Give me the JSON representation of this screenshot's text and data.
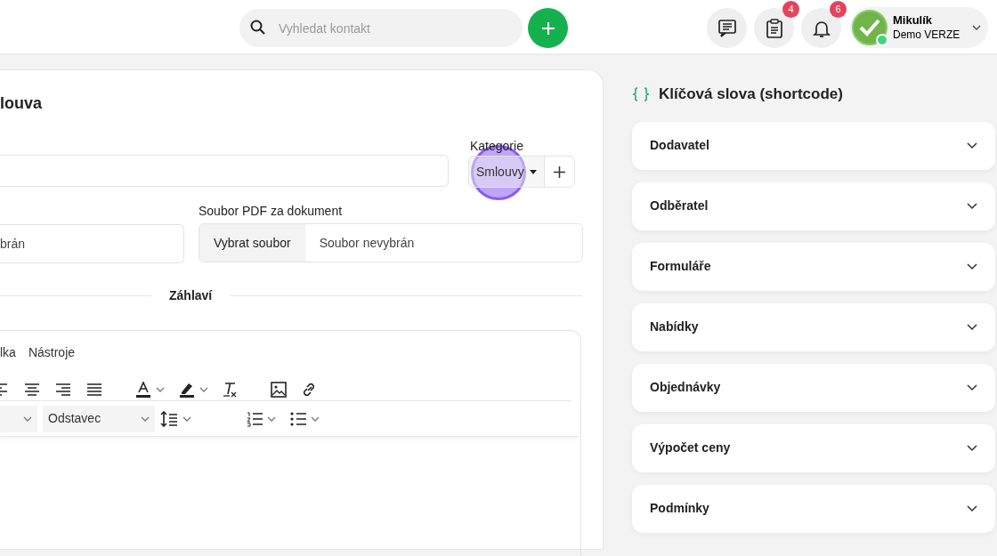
{
  "search": {
    "placeholder": "Vyhledat kontakt"
  },
  "header_buttons": [
    {
      "kind": "messages"
    },
    {
      "kind": "clipboard",
      "badge": "4"
    },
    {
      "kind": "bell",
      "badge": "6"
    }
  ],
  "user": {
    "name": "Mikulík",
    "role": "Demo VERZE",
    "online": true
  },
  "form": {
    "title": "louva",
    "category": {
      "label": "Kategorie",
      "value": "Smlouvy",
      "click_highlight": true
    },
    "left_field": {
      "value": "brán"
    },
    "pdf": {
      "label": "Soubor PDF za dokument",
      "button": "Vybrat soubor",
      "value": "Soubor nevybrán"
    },
    "section": "Záhlaví",
    "editor": {
      "menu": [
        "lka",
        "Nástroje"
      ],
      "toolbar": [
        {
          "kind": "align-left"
        },
        {
          "kind": "align-center"
        },
        {
          "kind": "align-right"
        },
        {
          "kind": "justify"
        },
        {
          "kind": "gap"
        },
        {
          "kind": "text-color"
        },
        {
          "kind": "highlight"
        },
        {
          "kind": "clear-format"
        },
        {
          "kind": "gap"
        },
        {
          "kind": "image"
        },
        {
          "kind": "link"
        }
      ],
      "format_row": [
        {
          "kind": "select"
        },
        {
          "kind": "select",
          "value": "Odstavec"
        },
        {
          "kind": "line-height"
        },
        {
          "kind": "gap"
        },
        {
          "kind": "ordered-list"
        },
        {
          "kind": "bullet-list"
        }
      ]
    }
  },
  "shortcodes": {
    "title": "Klíčová slova (shortcode)",
    "items": [
      {
        "label": "Dodavatel",
        "expanded": false
      },
      {
        "label": "Odběratel",
        "expanded": false
      },
      {
        "label": "Formuláře",
        "expanded": false
      },
      {
        "label": "Nabídky",
        "expanded": false
      },
      {
        "label": "Objednávky",
        "expanded": false
      },
      {
        "label": "Výpočet ceny",
        "expanded": false
      },
      {
        "label": "Podmínky",
        "expanded": false
      }
    ]
  }
}
